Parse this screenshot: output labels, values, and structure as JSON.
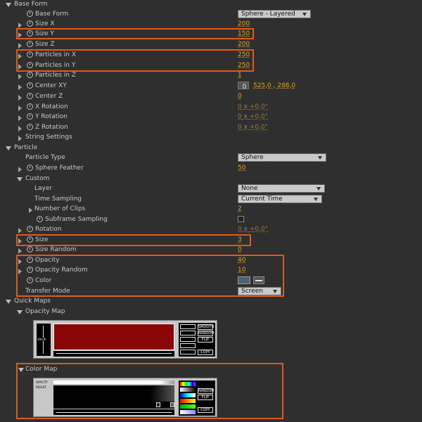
{
  "sections": {
    "base_form": "Base Form",
    "particle": "Particle",
    "quick_maps": "Quick Maps"
  },
  "base_form": {
    "base_form_label": "Base Form",
    "base_form_value": "Sphere - Layered",
    "size_x_label": "Size X",
    "size_x": "200",
    "size_y_label": "Size Y",
    "size_y": "150",
    "size_z_label": "Size Z",
    "size_z": "200",
    "particles_x_label": "Particles in X",
    "particles_x": "250",
    "particles_y_label": "Particles in Y",
    "particles_y": "250",
    "particles_z_label": "Particles in Z",
    "particles_z": "1",
    "center_xy_label": "Center XY",
    "center_xy": "525,0 , 288,0",
    "center_z_label": "Center Z",
    "center_z": "0",
    "x_rot_label": "X Rotation",
    "x_rot_turns": "0",
    "x_rot_deg": "+0,0°",
    "y_rot_label": "Y Rotation",
    "y_rot_turns": "0",
    "y_rot_deg": "+0,0°",
    "z_rot_label": "Z Rotation",
    "z_rot_turns": "0",
    "z_rot_deg": "+0,0°",
    "string_settings_label": "String Settings"
  },
  "particle": {
    "type_label": "Particle Type",
    "type_value": "Sphere",
    "feather_label": "Sphere Feather",
    "feather": "50",
    "custom_label": "Custom",
    "layer_label": "Layer",
    "layer_value": "None",
    "time_sampling_label": "Time Sampling",
    "time_sampling_value": "Current Time",
    "clips_label": "Number of Clips",
    "clips": "2",
    "subframe_label": "Subframe Sampling",
    "rotation_label": "Rotation",
    "rotation_turns": "0",
    "rotation_deg": "+0,0°",
    "size_label": "Size",
    "size": "3",
    "size_random_label": "Size Random",
    "size_random": "0",
    "opacity_label": "Opacity",
    "opacity": "40",
    "opacity_random_label": "Opacity Random",
    "opacity_random": "10",
    "color_label": "Color",
    "color_hex": "#4c6470",
    "transfer_label": "Transfer Mode",
    "transfer_value": "Screen"
  },
  "quick_maps": {
    "opacity_map_label": "Opacity Map",
    "color_map_label": "Color Map",
    "value_label": "VALUE",
    "opacity_label": "OPACITY",
    "result_label": "RESULT",
    "smooth_label": "SMOOTH",
    "random_label": "RANDOM",
    "flip_label": "FLIP",
    "copy_label": "COPY",
    "opacity_map_color": "#8a0505"
  }
}
